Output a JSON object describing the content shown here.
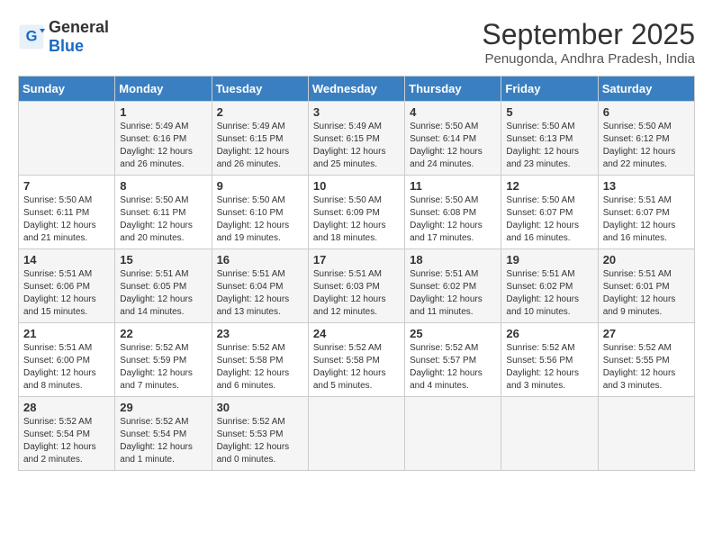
{
  "logo": {
    "general": "General",
    "blue": "Blue"
  },
  "header": {
    "month": "September 2025",
    "location": "Penugonda, Andhra Pradesh, India"
  },
  "weekdays": [
    "Sunday",
    "Monday",
    "Tuesday",
    "Wednesday",
    "Thursday",
    "Friday",
    "Saturday"
  ],
  "weeks": [
    [
      {
        "day": "",
        "info": ""
      },
      {
        "day": "1",
        "info": "Sunrise: 5:49 AM\nSunset: 6:16 PM\nDaylight: 12 hours\nand 26 minutes."
      },
      {
        "day": "2",
        "info": "Sunrise: 5:49 AM\nSunset: 6:15 PM\nDaylight: 12 hours\nand 26 minutes."
      },
      {
        "day": "3",
        "info": "Sunrise: 5:49 AM\nSunset: 6:15 PM\nDaylight: 12 hours\nand 25 minutes."
      },
      {
        "day": "4",
        "info": "Sunrise: 5:50 AM\nSunset: 6:14 PM\nDaylight: 12 hours\nand 24 minutes."
      },
      {
        "day": "5",
        "info": "Sunrise: 5:50 AM\nSunset: 6:13 PM\nDaylight: 12 hours\nand 23 minutes."
      },
      {
        "day": "6",
        "info": "Sunrise: 5:50 AM\nSunset: 6:12 PM\nDaylight: 12 hours\nand 22 minutes."
      }
    ],
    [
      {
        "day": "7",
        "info": "Sunrise: 5:50 AM\nSunset: 6:11 PM\nDaylight: 12 hours\nand 21 minutes."
      },
      {
        "day": "8",
        "info": "Sunrise: 5:50 AM\nSunset: 6:11 PM\nDaylight: 12 hours\nand 20 minutes."
      },
      {
        "day": "9",
        "info": "Sunrise: 5:50 AM\nSunset: 6:10 PM\nDaylight: 12 hours\nand 19 minutes."
      },
      {
        "day": "10",
        "info": "Sunrise: 5:50 AM\nSunset: 6:09 PM\nDaylight: 12 hours\nand 18 minutes."
      },
      {
        "day": "11",
        "info": "Sunrise: 5:50 AM\nSunset: 6:08 PM\nDaylight: 12 hours\nand 17 minutes."
      },
      {
        "day": "12",
        "info": "Sunrise: 5:50 AM\nSunset: 6:07 PM\nDaylight: 12 hours\nand 16 minutes."
      },
      {
        "day": "13",
        "info": "Sunrise: 5:51 AM\nSunset: 6:07 PM\nDaylight: 12 hours\nand 16 minutes."
      }
    ],
    [
      {
        "day": "14",
        "info": "Sunrise: 5:51 AM\nSunset: 6:06 PM\nDaylight: 12 hours\nand 15 minutes."
      },
      {
        "day": "15",
        "info": "Sunrise: 5:51 AM\nSunset: 6:05 PM\nDaylight: 12 hours\nand 14 minutes."
      },
      {
        "day": "16",
        "info": "Sunrise: 5:51 AM\nSunset: 6:04 PM\nDaylight: 12 hours\nand 13 minutes."
      },
      {
        "day": "17",
        "info": "Sunrise: 5:51 AM\nSunset: 6:03 PM\nDaylight: 12 hours\nand 12 minutes."
      },
      {
        "day": "18",
        "info": "Sunrise: 5:51 AM\nSunset: 6:02 PM\nDaylight: 12 hours\nand 11 minutes."
      },
      {
        "day": "19",
        "info": "Sunrise: 5:51 AM\nSunset: 6:02 PM\nDaylight: 12 hours\nand 10 minutes."
      },
      {
        "day": "20",
        "info": "Sunrise: 5:51 AM\nSunset: 6:01 PM\nDaylight: 12 hours\nand 9 minutes."
      }
    ],
    [
      {
        "day": "21",
        "info": "Sunrise: 5:51 AM\nSunset: 6:00 PM\nDaylight: 12 hours\nand 8 minutes."
      },
      {
        "day": "22",
        "info": "Sunrise: 5:52 AM\nSunset: 5:59 PM\nDaylight: 12 hours\nand 7 minutes."
      },
      {
        "day": "23",
        "info": "Sunrise: 5:52 AM\nSunset: 5:58 PM\nDaylight: 12 hours\nand 6 minutes."
      },
      {
        "day": "24",
        "info": "Sunrise: 5:52 AM\nSunset: 5:58 PM\nDaylight: 12 hours\nand 5 minutes."
      },
      {
        "day": "25",
        "info": "Sunrise: 5:52 AM\nSunset: 5:57 PM\nDaylight: 12 hours\nand 4 minutes."
      },
      {
        "day": "26",
        "info": "Sunrise: 5:52 AM\nSunset: 5:56 PM\nDaylight: 12 hours\nand 3 minutes."
      },
      {
        "day": "27",
        "info": "Sunrise: 5:52 AM\nSunset: 5:55 PM\nDaylight: 12 hours\nand 3 minutes."
      }
    ],
    [
      {
        "day": "28",
        "info": "Sunrise: 5:52 AM\nSunset: 5:54 PM\nDaylight: 12 hours\nand 2 minutes."
      },
      {
        "day": "29",
        "info": "Sunrise: 5:52 AM\nSunset: 5:54 PM\nDaylight: 12 hours\nand 1 minute."
      },
      {
        "day": "30",
        "info": "Sunrise: 5:52 AM\nSunset: 5:53 PM\nDaylight: 12 hours\nand 0 minutes."
      },
      {
        "day": "",
        "info": ""
      },
      {
        "day": "",
        "info": ""
      },
      {
        "day": "",
        "info": ""
      },
      {
        "day": "",
        "info": ""
      }
    ]
  ]
}
